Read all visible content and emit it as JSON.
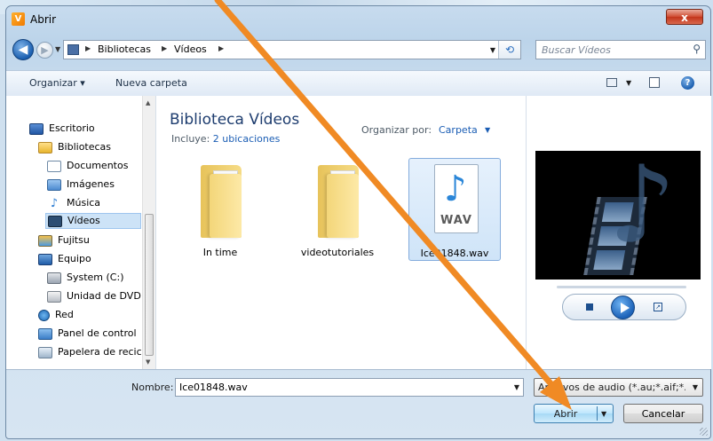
{
  "window": {
    "title": "Abrir",
    "close_glyph": "x"
  },
  "address_bar": {
    "breadcrumbs": [
      "Bibliotecas",
      "Vídeos"
    ],
    "search_placeholder": "Buscar Vídeos"
  },
  "toolbar": {
    "organize": "Organizar ▾",
    "new_folder": "Nueva carpeta",
    "help": "?"
  },
  "sidebar": {
    "items": [
      {
        "label": "Escritorio",
        "icon": "desktop-icon"
      },
      {
        "label": "Bibliotecas",
        "icon": "library-icon"
      },
      {
        "label": "Documentos",
        "icon": "documents-icon"
      },
      {
        "label": "Imágenes",
        "icon": "pictures-icon"
      },
      {
        "label": "Música",
        "icon": "music-icon"
      },
      {
        "label": "Vídeos",
        "icon": "videos-icon",
        "selected": true
      },
      {
        "label": "Fujitsu",
        "icon": "user-icon"
      },
      {
        "label": "Equipo",
        "icon": "computer-icon"
      },
      {
        "label": "System (C:)",
        "icon": "drive-icon"
      },
      {
        "label": "Unidad de DVD",
        "icon": "dvd-icon"
      },
      {
        "label": "Red",
        "icon": "network-icon"
      },
      {
        "label": "Panel de control",
        "icon": "control-panel-icon"
      },
      {
        "label": "Papelera de recic",
        "icon": "recycle-bin-icon"
      }
    ]
  },
  "library": {
    "title": "Biblioteca Vídeos",
    "includes_label": "Incluye:",
    "includes_link": "2 ubicaciones",
    "arrange_label": "Organizar por:",
    "arrange_value": "Carpeta"
  },
  "files": [
    {
      "name": "In time",
      "type": "folder"
    },
    {
      "name": "videotutoriales",
      "type": "folder"
    },
    {
      "name": "Ice01848.wav",
      "type": "wav",
      "badge": "WAV",
      "selected": true
    }
  ],
  "bottom": {
    "name_label": "Nombre:",
    "name_value": "Ice01848.wav",
    "file_type": "Archivos de audio (*.au;*.aif;*.a",
    "open_button": "Abrir",
    "cancel_button": "Cancelar"
  },
  "colors": {
    "annotation_arrow": "#f08a24",
    "accent": "#1a5db4"
  }
}
